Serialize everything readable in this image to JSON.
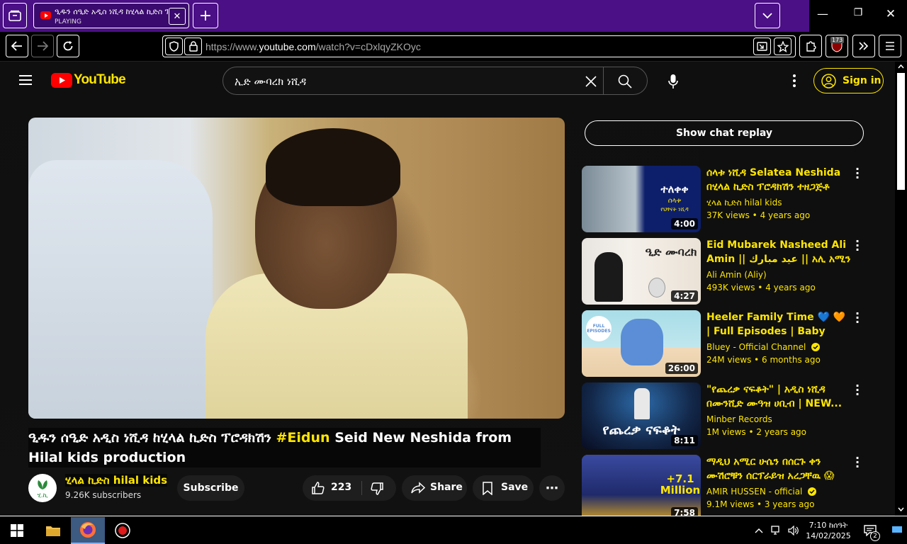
{
  "browser": {
    "tab": {
      "title": "ዒዱን ሰዒድ አዲስ ነሺዳ ከሂላል ኪድስ ፕሮዳክሽን",
      "status": "PLAYING",
      "close_glyph": "✕"
    },
    "new_tab_glyph": "+",
    "url": {
      "prefix": "https://www.",
      "domain": "youtube.com",
      "path": "/watch?v=cDxlqyZKOyc"
    },
    "extension_badge": "173",
    "window_controls": {
      "minimize": "—",
      "restore": "❐",
      "close": "✕"
    }
  },
  "youtube": {
    "logo_text": "YouTube",
    "search": {
      "query": "ኢድ ሙባረክ ነሺዳ"
    },
    "sign_in_label": "Sign in",
    "video": {
      "title_prefix": "ዒዱን ሰዒድ አዲስ ነሺዳ ከሂላል ኪድስ ፕሮዳክሽን ",
      "title_hashtag": "#Eidun",
      "title_suffix": " Seid New Neshida from Hilal kids production",
      "channel_name": "ሂላል ኪድስ hilal kids",
      "subscribers": "9.26K subscribers",
      "subscribe_label": "Subscribe",
      "likes": "223",
      "share_label": "Share",
      "save_label": "Save",
      "more_glyph": "⋯",
      "avatar_text": "ሂ.ኪ"
    },
    "chat_replay_label": "Show chat replay",
    "recommendations": [
      {
        "title": "ሰላቱ ነሺዳ Selatea Neshida በሂላል ኪድስ ፕሮዳክሽን ተዘጋጅቶ የቀረበ...",
        "channel": "ሂላል ኪድስ hilal kids",
        "views": "37K views",
        "age": "4 years ago",
        "duration": "4:00",
        "thumb_text": "ተለቀቀ",
        "thumb_sub": "ሰላቱ",
        "thumb_sub2": "የህፃናት ነሺዳ",
        "verified": false
      },
      {
        "title": "Eid Mubarek Nasheed Ali Amin || عيد مبارك || አሊ አሚን ዒድ ሙባረ...",
        "channel": "Ali Amin (Aliy)",
        "views": "493K views",
        "age": "4 years ago",
        "duration": "4:27",
        "thumb_text": "ዒድ ሙባረክ",
        "verified": false
      },
      {
        "title": "Heeler Family Time 💙 🧡 | Full Episodes | Baby Race,...",
        "channel": "Bluey - Official Channel",
        "views": "24M views",
        "age": "6 months ago",
        "duration": "26:00",
        "thumb_text": "FULL EPISODES",
        "verified": true
      },
      {
        "title": "\"የጨረቃ ናፍቆት\" | አዲስ ነሺዳ በሙንሺድ ሙዓዝ ሀቢብ | NEW...",
        "channel": "Minber Records",
        "views": "1M views",
        "age": "2 years ago",
        "duration": "8:11",
        "thumb_text": "የጨረቃ ናፍቆት",
        "verified": false
      },
      {
        "title": "ማዲህ አሚር ሁሴን በሰርጉ ቀን ሙሽሮቹን ሰርፕራይዝ አረጋቸዉ 😱 /...",
        "channel": "AMIR HUSSEN - official",
        "views": "9.1M views",
        "age": "3 years ago",
        "duration": "7:58",
        "thumb_text": "+7.1 Million",
        "verified": true
      }
    ]
  },
  "taskbar": {
    "time": "7:10 ከሰዓት",
    "date": "14/02/2025",
    "notification_count": "2"
  },
  "colors": {
    "accent": "#ffe600",
    "tabbar": "#4b0f86",
    "youtube_red": "#ff0000"
  }
}
